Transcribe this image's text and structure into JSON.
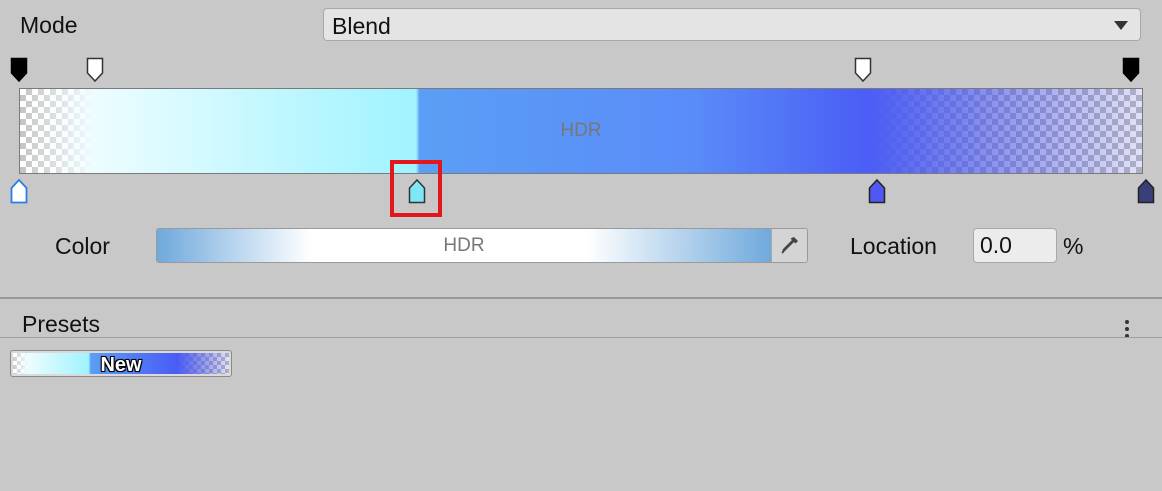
{
  "mode": {
    "label": "Mode",
    "selected": "Blend"
  },
  "gradient": {
    "hdr_label": "HDR",
    "alpha_keys": [
      {
        "id": "alpha-key-1",
        "color": "#000000"
      },
      {
        "id": "alpha-key-2",
        "color": "#ffffff"
      },
      {
        "id": "alpha-key-3",
        "color": "#ffffff"
      },
      {
        "id": "alpha-key-4",
        "color": "#000000"
      }
    ],
    "color_keys": [
      {
        "id": "color-key-1",
        "color": "#ffffff",
        "outline": "#2e7be6"
      },
      {
        "id": "color-key-2",
        "color": "#7fe6f5",
        "outline": "#333333",
        "selected": true
      },
      {
        "id": "color-key-3",
        "color": "#4f58f0",
        "outline": "#222222"
      },
      {
        "id": "color-key-4",
        "color": "#3a3f7a",
        "outline": "#222222"
      }
    ]
  },
  "color_row": {
    "label": "Color",
    "hdr_label": "HDR",
    "swatch_color": "#6fa9dc",
    "location_label": "Location",
    "location_value": "0.0",
    "percent": "%"
  },
  "presets": {
    "label": "Presets",
    "items": [
      {
        "label": "New"
      }
    ]
  },
  "colors": {
    "background": "#c8c8c8",
    "selection_highlight": "#e2171b"
  }
}
